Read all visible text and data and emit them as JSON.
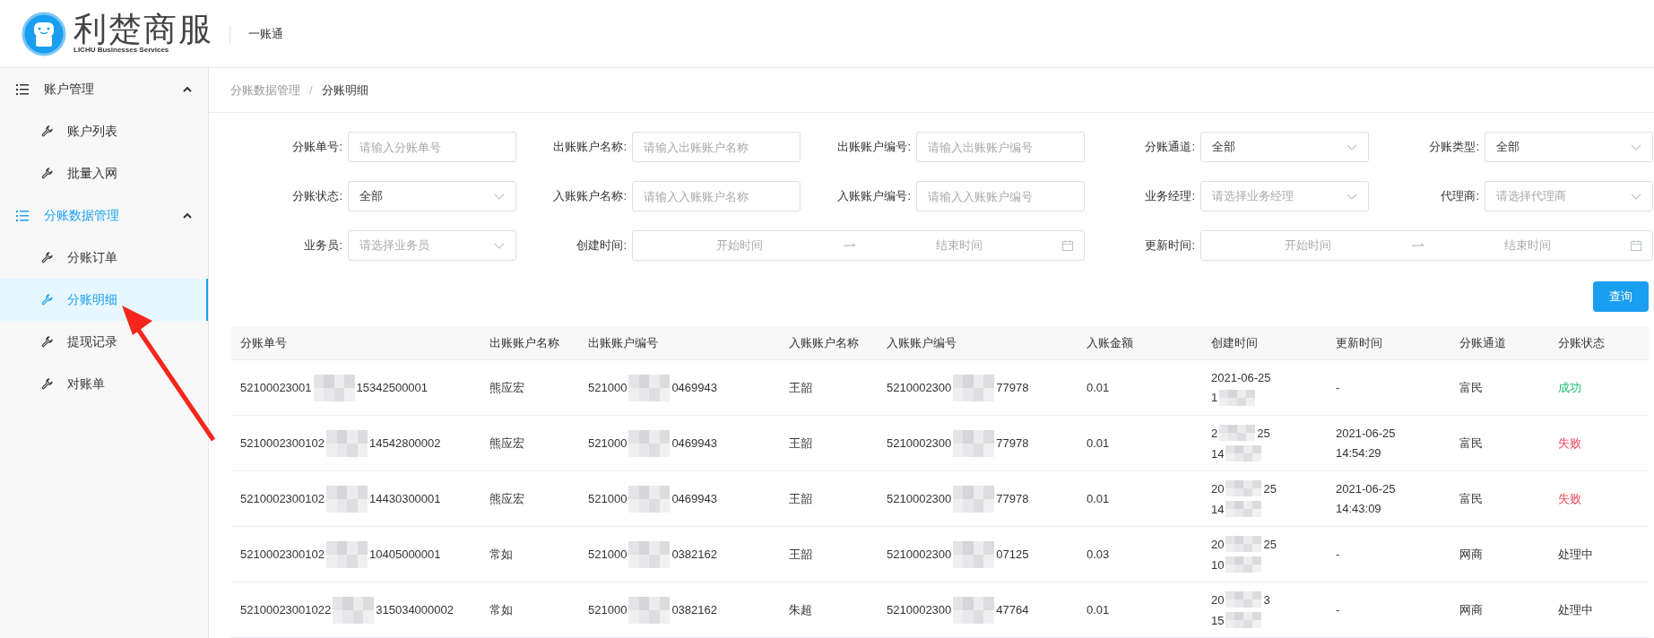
{
  "header": {
    "logo_title": "利楚商服",
    "logo_subtitle": "LICHU Businesses Services",
    "app_name": "一账通"
  },
  "sidebar": [
    {
      "label": "账户管理",
      "expanded": true,
      "active": false,
      "children": [
        {
          "label": "账户列表",
          "selected": false
        },
        {
          "label": "批量入网",
          "selected": false
        }
      ]
    },
    {
      "label": "分账数据管理",
      "expanded": true,
      "active": true,
      "children": [
        {
          "label": "分账订单",
          "selected": false
        },
        {
          "label": "分账明细",
          "selected": true
        },
        {
          "label": "提现记录",
          "selected": false
        },
        {
          "label": "对账单",
          "selected": false
        }
      ]
    }
  ],
  "breadcrumb": {
    "items": [
      "分账数据管理",
      "分账明细"
    ],
    "separator": "/"
  },
  "filters": [
    {
      "label": "分账单号:",
      "kind": "input",
      "placeholder": "请输入分账单号"
    },
    {
      "label": "出账账户名称:",
      "kind": "input",
      "placeholder": "请输入出账账户名称"
    },
    {
      "label": "出账账户编号:",
      "kind": "input",
      "placeholder": "请输入出账账户编号"
    },
    {
      "label": "分账通道:",
      "kind": "select",
      "value": "全部"
    },
    {
      "label": "分账类型:",
      "kind": "select",
      "value": "全部"
    },
    {
      "label": "分账状态:",
      "kind": "select",
      "value": "全部"
    },
    {
      "label": "入账账户名称:",
      "kind": "input",
      "placeholder": "请输入入账账户名称"
    },
    {
      "label": "入账账户编号:",
      "kind": "input",
      "placeholder": "请输入入账账户编号"
    },
    {
      "label": "业务经理:",
      "kind": "select",
      "placeholder": "请选择业务经理"
    },
    {
      "label": "代理商:",
      "kind": "select",
      "placeholder": "请选择代理商"
    },
    {
      "label": "业务员:",
      "kind": "select",
      "placeholder": "请选择业务员"
    },
    {
      "label": "创建时间:",
      "kind": "daterange",
      "start_placeholder": "开始时间",
      "end_placeholder": "结束时间"
    },
    {
      "label": "更新时间:",
      "kind": "daterange",
      "start_placeholder": "开始时间",
      "end_placeholder": "结束时间"
    }
  ],
  "query_button": "查询",
  "table": {
    "columns": [
      "分账单号",
      "出账账户名称",
      "出账账户编号",
      "入账账户名称",
      "入账账户编号",
      "入账金额",
      "创建时间",
      "更新时间",
      "分账通道",
      "分账状态"
    ],
    "rows": [
      {
        "order_no": [
          "52100023001",
          "15342500001"
        ],
        "out_name": "熊应宏",
        "out_no": [
          "521000",
          "0469943"
        ],
        "in_name": "王韶",
        "in_no": [
          "5210002300",
          "77978"
        ],
        "amount": "0.01",
        "created": {
          "date": [
            "2021-06-25"
          ],
          "time": "1"
        },
        "updated": [
          "-"
        ],
        "channel": "富民",
        "status": "成功",
        "kind": "success"
      },
      {
        "order_no": [
          "5210002300102",
          "14542800002"
        ],
        "out_name": "熊应宏",
        "out_no": [
          "521000",
          "0469943"
        ],
        "in_name": "王韶",
        "in_no": [
          "5210002300",
          "77978"
        ],
        "amount": "0.01",
        "created": {
          "date": [
            "2",
            "25"
          ],
          "time": "14"
        },
        "updated": [
          "2021-06-25",
          "14:54:29"
        ],
        "channel": "富民",
        "status": "失败",
        "kind": "fail"
      },
      {
        "order_no": [
          "5210002300102",
          "14430300001"
        ],
        "out_name": "熊应宏",
        "out_no": [
          "521000",
          "0469943"
        ],
        "in_name": "王韶",
        "in_no": [
          "5210002300",
          "77978"
        ],
        "amount": "0.01",
        "created": {
          "date": [
            "20",
            "25"
          ],
          "time": "14"
        },
        "updated": [
          "2021-06-25",
          "14:43:09"
        ],
        "channel": "富民",
        "status": "失败",
        "kind": "fail"
      },
      {
        "order_no": [
          "5210002300102",
          "10405000001"
        ],
        "out_name": "常如",
        "out_no": [
          "521000",
          "0382162"
        ],
        "in_name": "王韶",
        "in_no": [
          "5210002300",
          "07125"
        ],
        "amount": "0.03",
        "created": {
          "date": [
            "20",
            "25"
          ],
          "time": "10"
        },
        "updated": [
          "-"
        ],
        "channel": "网商",
        "status": "处理中",
        "kind": "pending"
      },
      {
        "order_no": [
          "52100023001022",
          "315034000002"
        ],
        "out_name": "常如",
        "out_no": [
          "521000",
          "0382162"
        ],
        "in_name": "朱超",
        "in_no": [
          "5210002300",
          "47764"
        ],
        "amount": "0.01",
        "created": {
          "date": [
            "20",
            "3"
          ],
          "time": "15"
        },
        "updated": [
          "-"
        ],
        "channel": "网商",
        "status": "处理中",
        "kind": "pending"
      }
    ]
  }
}
